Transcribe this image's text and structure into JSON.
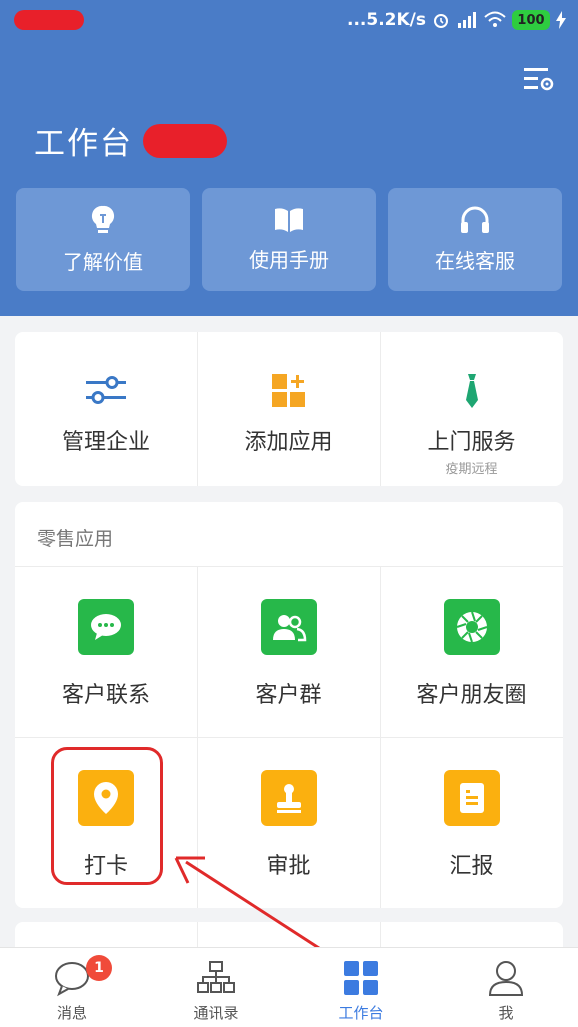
{
  "status_bar": {
    "network_speed": "...5.2K/s",
    "battery": "100"
  },
  "header": {
    "title": "工作台 ·"
  },
  "quick_actions": [
    {
      "label": "了解价值",
      "icon": "lightbulb-icon"
    },
    {
      "label": "使用手册",
      "icon": "book-icon"
    },
    {
      "label": "在线客服",
      "icon": "headphones-icon"
    }
  ],
  "top_apps": [
    {
      "label": "管理企业",
      "icon": "sliders-icon"
    },
    {
      "label": "添加应用",
      "icon": "add-apps-icon"
    },
    {
      "label": "上门服务",
      "sub": "疫期远程",
      "icon": "necktie-icon"
    }
  ],
  "retail": {
    "section_title": "零售应用",
    "apps": [
      {
        "label": "客户联系",
        "icon": "chat-bubble-icon",
        "color": "#27b84a"
      },
      {
        "label": "客户群",
        "icon": "group-icon",
        "color": "#27b84a"
      },
      {
        "label": "客户朋友圈",
        "icon": "camera-shutter-icon",
        "color": "#27b84a"
      },
      {
        "label": "打卡",
        "icon": "location-pin-icon",
        "color": "#fbb00f"
      },
      {
        "label": "审批",
        "icon": "stamp-icon",
        "color": "#fbb00f"
      },
      {
        "label": "汇报",
        "icon": "document-icon",
        "color": "#fbb00f"
      }
    ]
  },
  "tabbar": {
    "items": [
      {
        "label": "消息",
        "icon": "message-icon",
        "badge": "1"
      },
      {
        "label": "通讯录",
        "icon": "org-chart-icon"
      },
      {
        "label": "工作台",
        "icon": "grid-icon",
        "active": true
      },
      {
        "label": "我",
        "icon": "person-icon"
      }
    ]
  },
  "colors": {
    "header": "#4a7cc7",
    "active_tab": "#3c7be0",
    "annotation": "#e02a2a"
  }
}
